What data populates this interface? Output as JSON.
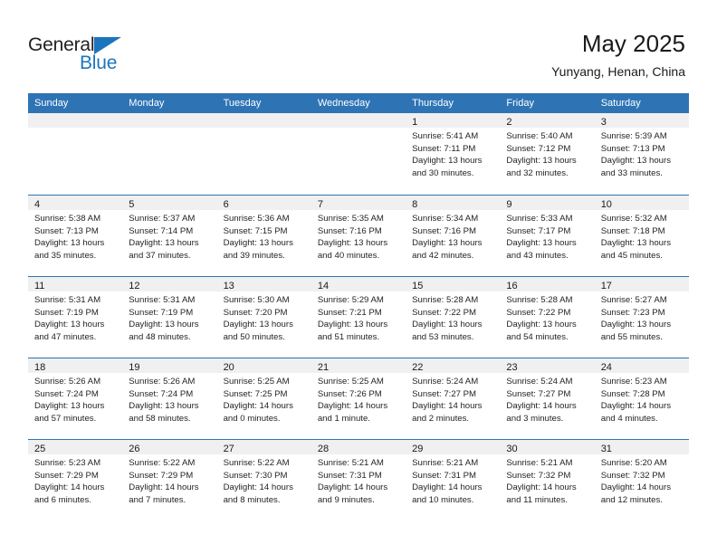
{
  "logo": {
    "word_top": "General",
    "word_bottom": "Blue",
    "triangle_color": "#1c75bc",
    "text_color": "#231f20"
  },
  "header": {
    "title": "May 2025",
    "subtitle": "Yunyang, Henan, China"
  },
  "colors": {
    "header_blue": "#2e74b5",
    "day_band": "#f0f0f0",
    "text": "#231f20"
  },
  "weekdays": [
    "Sunday",
    "Monday",
    "Tuesday",
    "Wednesday",
    "Thursday",
    "Friday",
    "Saturday"
  ],
  "weeks": [
    [
      {
        "day": "",
        "empty": true
      },
      {
        "day": "",
        "empty": true
      },
      {
        "day": "",
        "empty": true
      },
      {
        "day": "",
        "empty": true
      },
      {
        "day": "1",
        "sunrise": "Sunrise: 5:41 AM",
        "sunset": "Sunset: 7:11 PM",
        "daylight1": "Daylight: 13 hours",
        "daylight2": "and 30 minutes."
      },
      {
        "day": "2",
        "sunrise": "Sunrise: 5:40 AM",
        "sunset": "Sunset: 7:12 PM",
        "daylight1": "Daylight: 13 hours",
        "daylight2": "and 32 minutes."
      },
      {
        "day": "3",
        "sunrise": "Sunrise: 5:39 AM",
        "sunset": "Sunset: 7:13 PM",
        "daylight1": "Daylight: 13 hours",
        "daylight2": "and 33 minutes."
      }
    ],
    [
      {
        "day": "4",
        "sunrise": "Sunrise: 5:38 AM",
        "sunset": "Sunset: 7:13 PM",
        "daylight1": "Daylight: 13 hours",
        "daylight2": "and 35 minutes."
      },
      {
        "day": "5",
        "sunrise": "Sunrise: 5:37 AM",
        "sunset": "Sunset: 7:14 PM",
        "daylight1": "Daylight: 13 hours",
        "daylight2": "and 37 minutes."
      },
      {
        "day": "6",
        "sunrise": "Sunrise: 5:36 AM",
        "sunset": "Sunset: 7:15 PM",
        "daylight1": "Daylight: 13 hours",
        "daylight2": "and 39 minutes."
      },
      {
        "day": "7",
        "sunrise": "Sunrise: 5:35 AM",
        "sunset": "Sunset: 7:16 PM",
        "daylight1": "Daylight: 13 hours",
        "daylight2": "and 40 minutes."
      },
      {
        "day": "8",
        "sunrise": "Sunrise: 5:34 AM",
        "sunset": "Sunset: 7:16 PM",
        "daylight1": "Daylight: 13 hours",
        "daylight2": "and 42 minutes."
      },
      {
        "day": "9",
        "sunrise": "Sunrise: 5:33 AM",
        "sunset": "Sunset: 7:17 PM",
        "daylight1": "Daylight: 13 hours",
        "daylight2": "and 43 minutes."
      },
      {
        "day": "10",
        "sunrise": "Sunrise: 5:32 AM",
        "sunset": "Sunset: 7:18 PM",
        "daylight1": "Daylight: 13 hours",
        "daylight2": "and 45 minutes."
      }
    ],
    [
      {
        "day": "11",
        "sunrise": "Sunrise: 5:31 AM",
        "sunset": "Sunset: 7:19 PM",
        "daylight1": "Daylight: 13 hours",
        "daylight2": "and 47 minutes."
      },
      {
        "day": "12",
        "sunrise": "Sunrise: 5:31 AM",
        "sunset": "Sunset: 7:19 PM",
        "daylight1": "Daylight: 13 hours",
        "daylight2": "and 48 minutes."
      },
      {
        "day": "13",
        "sunrise": "Sunrise: 5:30 AM",
        "sunset": "Sunset: 7:20 PM",
        "daylight1": "Daylight: 13 hours",
        "daylight2": "and 50 minutes."
      },
      {
        "day": "14",
        "sunrise": "Sunrise: 5:29 AM",
        "sunset": "Sunset: 7:21 PM",
        "daylight1": "Daylight: 13 hours",
        "daylight2": "and 51 minutes."
      },
      {
        "day": "15",
        "sunrise": "Sunrise: 5:28 AM",
        "sunset": "Sunset: 7:22 PM",
        "daylight1": "Daylight: 13 hours",
        "daylight2": "and 53 minutes."
      },
      {
        "day": "16",
        "sunrise": "Sunrise: 5:28 AM",
        "sunset": "Sunset: 7:22 PM",
        "daylight1": "Daylight: 13 hours",
        "daylight2": "and 54 minutes."
      },
      {
        "day": "17",
        "sunrise": "Sunrise: 5:27 AM",
        "sunset": "Sunset: 7:23 PM",
        "daylight1": "Daylight: 13 hours",
        "daylight2": "and 55 minutes."
      }
    ],
    [
      {
        "day": "18",
        "sunrise": "Sunrise: 5:26 AM",
        "sunset": "Sunset: 7:24 PM",
        "daylight1": "Daylight: 13 hours",
        "daylight2": "and 57 minutes."
      },
      {
        "day": "19",
        "sunrise": "Sunrise: 5:26 AM",
        "sunset": "Sunset: 7:24 PM",
        "daylight1": "Daylight: 13 hours",
        "daylight2": "and 58 minutes."
      },
      {
        "day": "20",
        "sunrise": "Sunrise: 5:25 AM",
        "sunset": "Sunset: 7:25 PM",
        "daylight1": "Daylight: 14 hours",
        "daylight2": "and 0 minutes."
      },
      {
        "day": "21",
        "sunrise": "Sunrise: 5:25 AM",
        "sunset": "Sunset: 7:26 PM",
        "daylight1": "Daylight: 14 hours",
        "daylight2": "and 1 minute."
      },
      {
        "day": "22",
        "sunrise": "Sunrise: 5:24 AM",
        "sunset": "Sunset: 7:27 PM",
        "daylight1": "Daylight: 14 hours",
        "daylight2": "and 2 minutes."
      },
      {
        "day": "23",
        "sunrise": "Sunrise: 5:24 AM",
        "sunset": "Sunset: 7:27 PM",
        "daylight1": "Daylight: 14 hours",
        "daylight2": "and 3 minutes."
      },
      {
        "day": "24",
        "sunrise": "Sunrise: 5:23 AM",
        "sunset": "Sunset: 7:28 PM",
        "daylight1": "Daylight: 14 hours",
        "daylight2": "and 4 minutes."
      }
    ],
    [
      {
        "day": "25",
        "sunrise": "Sunrise: 5:23 AM",
        "sunset": "Sunset: 7:29 PM",
        "daylight1": "Daylight: 14 hours",
        "daylight2": "and 6 minutes."
      },
      {
        "day": "26",
        "sunrise": "Sunrise: 5:22 AM",
        "sunset": "Sunset: 7:29 PM",
        "daylight1": "Daylight: 14 hours",
        "daylight2": "and 7 minutes."
      },
      {
        "day": "27",
        "sunrise": "Sunrise: 5:22 AM",
        "sunset": "Sunset: 7:30 PM",
        "daylight1": "Daylight: 14 hours",
        "daylight2": "and 8 minutes."
      },
      {
        "day": "28",
        "sunrise": "Sunrise: 5:21 AM",
        "sunset": "Sunset: 7:31 PM",
        "daylight1": "Daylight: 14 hours",
        "daylight2": "and 9 minutes."
      },
      {
        "day": "29",
        "sunrise": "Sunrise: 5:21 AM",
        "sunset": "Sunset: 7:31 PM",
        "daylight1": "Daylight: 14 hours",
        "daylight2": "and 10 minutes."
      },
      {
        "day": "30",
        "sunrise": "Sunrise: 5:21 AM",
        "sunset": "Sunset: 7:32 PM",
        "daylight1": "Daylight: 14 hours",
        "daylight2": "and 11 minutes."
      },
      {
        "day": "31",
        "sunrise": "Sunrise: 5:20 AM",
        "sunset": "Sunset: 7:32 PM",
        "daylight1": "Daylight: 14 hours",
        "daylight2": "and 12 minutes."
      }
    ]
  ]
}
